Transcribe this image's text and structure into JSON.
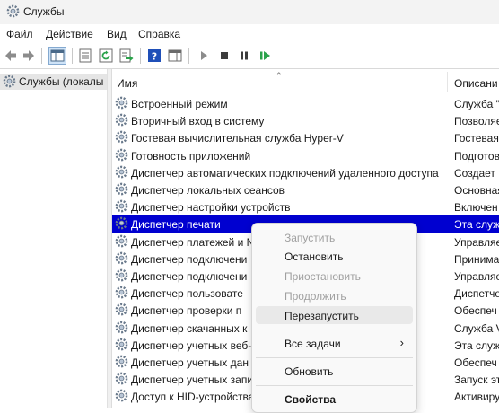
{
  "window": {
    "title": "Службы"
  },
  "menu": [
    "Файл",
    "Действие",
    "Вид",
    "Справка"
  ],
  "tree": {
    "selected_label": "Службы (локалы"
  },
  "columns": {
    "name": "Имя",
    "description": "Описани"
  },
  "rows": [
    {
      "name": "Встроенный режим",
      "description": "Служба \""
    },
    {
      "name": "Вторичный вход в систему",
      "description": "Позволяе"
    },
    {
      "name": "Гостевая вычислительная служба Hyper-V",
      "description": "Гостевая"
    },
    {
      "name": "Готовность приложений",
      "description": "Подготов"
    },
    {
      "name": "Диспетчер автоматических подключений удаленного доступа",
      "description": "Создает г"
    },
    {
      "name": "Диспетчер локальных сеансов",
      "description": "Основная"
    },
    {
      "name": "Диспетчер настройки устройств",
      "description": "Включен"
    },
    {
      "name": "Диспетчер печати",
      "description": "Эта служ"
    },
    {
      "name": "Диспетчер платежей и N",
      "description": "Управляе"
    },
    {
      "name": "Диспетчер подключени",
      "description": "Принима"
    },
    {
      "name": "Диспетчер подключени",
      "description": "Управляе"
    },
    {
      "name": "Диспетчер пользовате",
      "description": "Диспетче"
    },
    {
      "name": "Диспетчер проверки п",
      "description": "Обеспеч"
    },
    {
      "name": "Диспетчер скачанных к",
      "description": "Служба V"
    },
    {
      "name": "Диспетчер учетных веб-",
      "description": "Эта служ"
    },
    {
      "name": "Диспетчер учетных дан",
      "description": "Обеспеч"
    },
    {
      "name": "Диспетчер учетных запи",
      "description": "Запуск эт"
    },
    {
      "name": "Доступ к HID-устройства",
      "description": "Активиру"
    }
  ],
  "selected_row_index": 7,
  "context_menu": {
    "start": "Запустить",
    "stop": "Остановить",
    "pause": "Приостановить",
    "resume": "Продолжить",
    "restart": "Перезапустить",
    "all_tasks": "Все задачи",
    "refresh": "Обновить",
    "properties": "Свойства"
  },
  "colors": {
    "selection": "#0000d0",
    "toolbar_play": "#2aa24a",
    "help_blue": "#1f4fb8"
  }
}
